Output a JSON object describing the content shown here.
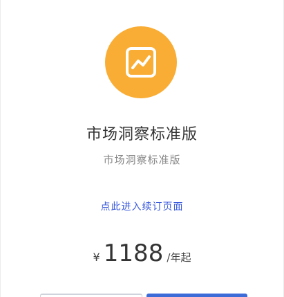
{
  "product": {
    "icon": "trend-chart-icon",
    "accent_color": "#f9ad34",
    "title": "市场洞察标准版",
    "subtitle": "市场洞察标准版",
    "order_link": "点此进入续订页面"
  },
  "pricing": {
    "currency": "¥",
    "amount": "1188",
    "unit": "/年起"
  },
  "buttons": {
    "primary_color": "#3d6bd8"
  }
}
